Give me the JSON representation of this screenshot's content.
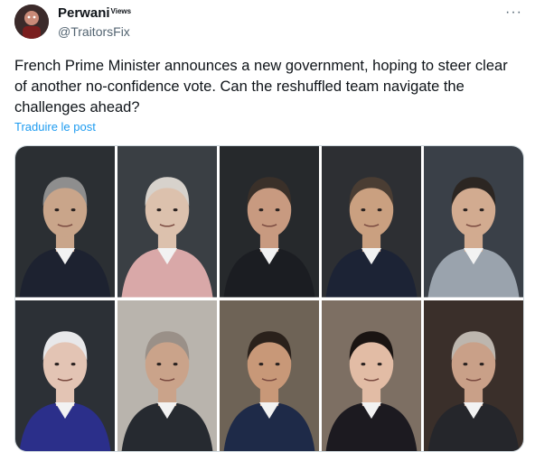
{
  "tweet": {
    "display_name": "Perwani",
    "name_badge": "Views",
    "handle": "@TraitorsFix",
    "more_label": "···",
    "text": "French Prime Minister announces a new government, hoping to steer clear of another no-confidence vote. Can the reshuffled team navigate the challenges ahead?",
    "translate_label": "Traduire le post"
  },
  "media": {
    "rows": 2,
    "columns": 5,
    "portraits": [
      {
        "bg": "#2b2f33",
        "suit": "#1d2230",
        "skin": "#c9a58a",
        "hair": "#8e8e8e"
      },
      {
        "bg": "#3a3f44",
        "suit": "#d9a8a8",
        "skin": "#dcc1ad",
        "hair": "#d7d2cc"
      },
      {
        "bg": "#26292c",
        "suit": "#1b1d22",
        "skin": "#c89a80",
        "hair": "#3a3029"
      },
      {
        "bg": "#2d2f33",
        "suit": "#1c2335",
        "skin": "#caa080",
        "hair": "#4a3d33"
      },
      {
        "bg": "#3a4048",
        "suit": "#9aa3ad",
        "skin": "#d2ab90",
        "hair": "#2c2622"
      },
      {
        "bg": "#2c3036",
        "suit": "#2b2f8a",
        "skin": "#e3c4b4",
        "hair": "#e8e8ea"
      },
      {
        "bg": "#b9b4ad",
        "suit": "#262a30",
        "skin": "#caa38a",
        "hair": "#9a9088"
      },
      {
        "bg": "#6e6356",
        "suit": "#1e2a48",
        "skin": "#c89878",
        "hair": "#2a211b"
      },
      {
        "bg": "#7d6f63",
        "suit": "#1c1a20",
        "skin": "#e2bca5",
        "hair": "#1a1412"
      },
      {
        "bg": "#3a2f2a",
        "suit": "#25262b",
        "skin": "#c9a088",
        "hair": "#bdb6ae"
      }
    ]
  }
}
